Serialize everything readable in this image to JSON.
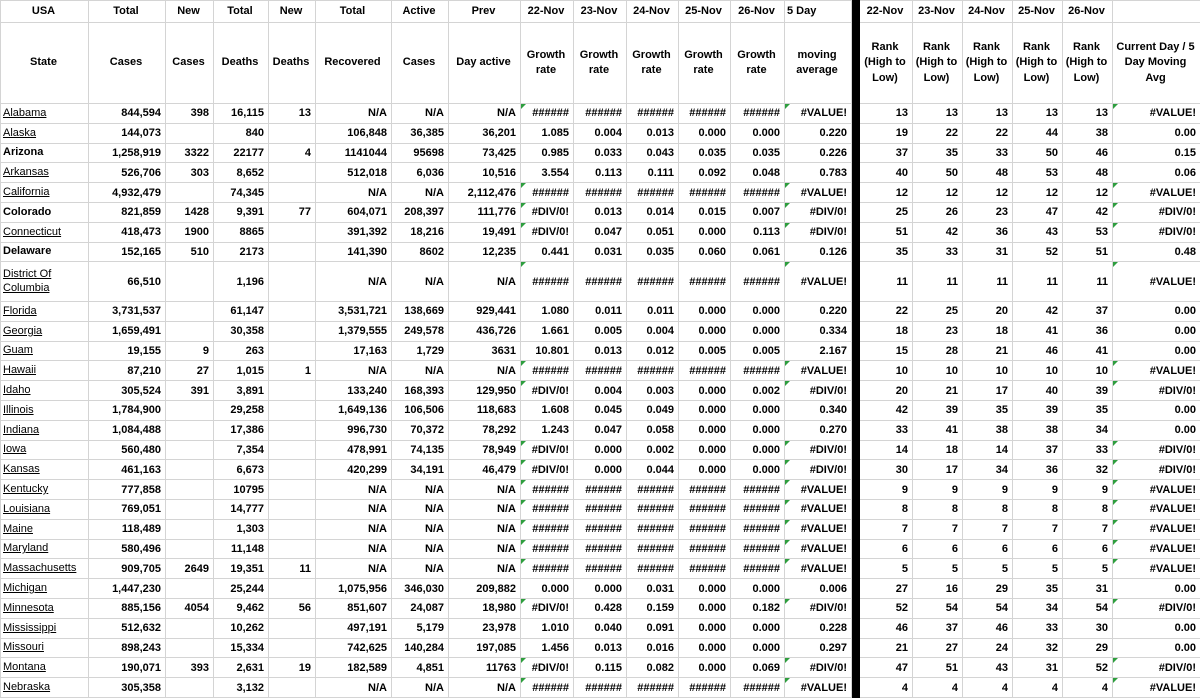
{
  "table": {
    "header_row1": [
      "USA",
      "Total",
      "New",
      "Total",
      "New",
      "Total",
      "Active",
      "Prev",
      "22-Nov",
      "23-Nov",
      "24-Nov",
      "25-Nov",
      "26-Nov",
      "5 Day",
      "22-Nov",
      "23-Nov",
      "24-Nov",
      "25-Nov",
      "26-Nov",
      ""
    ],
    "header_row2": [
      "State",
      "Cases",
      "Cases",
      "Deaths",
      "Deaths",
      "Recovered",
      "Cases",
      "Day active",
      "Growth rate",
      "Growth rate",
      "Growth rate",
      "Growth rate",
      "Growth rate",
      "moving average",
      "Rank (High to Low)",
      "Rank (High to Low)",
      "Rank (High to Low)",
      "Rank (High to Low)",
      "Rank (High to Low)",
      "Current Day / 5 Day Moving Avg"
    ],
    "error_flag_color": "#2e9e3e",
    "divider_color": "#000000",
    "rows": [
      {
        "state": "Alabama",
        "style": "underline",
        "cells": [
          "844,594",
          "398",
          "16,115",
          "13",
          "N/A",
          "N/A",
          "N/A",
          "######",
          "######",
          "######",
          "######",
          "######",
          "#VALUE!",
          "13",
          "13",
          "13",
          "13",
          "13",
          "#VALUE!"
        ]
      },
      {
        "state": "Alaska",
        "style": "underline",
        "cells": [
          "144,073",
          "",
          "840",
          "",
          "106,848",
          "36,385",
          "36,201",
          "1.085",
          "0.004",
          "0.013",
          "0.000",
          "0.000",
          "0.220",
          "19",
          "22",
          "22",
          "44",
          "38",
          "0.00"
        ]
      },
      {
        "state": "Arizona",
        "style": "bold",
        "cells": [
          "1,258,919",
          "3322",
          "22177",
          "4",
          "1141044",
          "95698",
          "73,425",
          "0.985",
          "0.033",
          "0.043",
          "0.035",
          "0.035",
          "0.226",
          "37",
          "35",
          "33",
          "50",
          "46",
          "0.15"
        ]
      },
      {
        "state": "Arkansas",
        "style": "underline",
        "cells": [
          "526,706",
          "303",
          "8,652",
          "",
          "512,018",
          "6,036",
          "10,516",
          "3.554",
          "0.113",
          "0.111",
          "0.092",
          "0.048",
          "0.783",
          "40",
          "50",
          "48",
          "53",
          "48",
          "0.06"
        ]
      },
      {
        "state": "California",
        "style": "underline",
        "cells": [
          "4,932,479",
          "",
          "74,345",
          "",
          "N/A",
          "N/A",
          "2,112,476",
          "######",
          "######",
          "######",
          "######",
          "######",
          "#VALUE!",
          "12",
          "12",
          "12",
          "12",
          "12",
          "#VALUE!"
        ]
      },
      {
        "state": "Colorado",
        "style": "bold",
        "cells": [
          "821,859",
          "1428",
          "9,391",
          "77",
          "604,071",
          "208,397",
          "111,776",
          "#DIV/0!",
          "0.013",
          "0.014",
          "0.015",
          "0.007",
          "#DIV/0!",
          "25",
          "26",
          "23",
          "47",
          "42",
          "#DIV/0!"
        ]
      },
      {
        "state": "Connecticut",
        "style": "underline",
        "cells": [
          "418,473",
          "1900",
          "8865",
          "",
          "391,392",
          "18,216",
          "19,491",
          "#DIV/0!",
          "0.047",
          "0.051",
          "0.000",
          "0.113",
          "#DIV/0!",
          "51",
          "42",
          "36",
          "43",
          "53",
          "#DIV/0!"
        ]
      },
      {
        "state": "Delaware",
        "style": "bold",
        "cells": [
          "152,165",
          "510",
          "2173",
          "",
          "141,390",
          "8602",
          "12,235",
          "0.441",
          "0.031",
          "0.035",
          "0.060",
          "0.061",
          "0.126",
          "35",
          "33",
          "31",
          "52",
          "51",
          "0.48"
        ]
      },
      {
        "state": "District Of Columbia",
        "style": "underline",
        "tall": true,
        "cells": [
          "66,510",
          "",
          "1,196",
          "",
          "N/A",
          "N/A",
          "N/A",
          "######",
          "######",
          "######",
          "######",
          "######",
          "#VALUE!",
          "11",
          "11",
          "11",
          "11",
          "11",
          "#VALUE!"
        ]
      },
      {
        "state": "Florida",
        "style": "underline",
        "cells": [
          "3,731,537",
          "",
          "61,147",
          "",
          "3,531,721",
          "138,669",
          "929,441",
          "1.080",
          "0.011",
          "0.011",
          "0.000",
          "0.000",
          "0.220",
          "22",
          "25",
          "20",
          "42",
          "37",
          "0.00"
        ]
      },
      {
        "state": "Georgia",
        "style": "underline",
        "cells": [
          "1,659,491",
          "",
          "30,358",
          "",
          "1,379,555",
          "249,578",
          "436,726",
          "1.661",
          "0.005",
          "0.004",
          "0.000",
          "0.000",
          "0.334",
          "18",
          "23",
          "18",
          "41",
          "36",
          "0.00"
        ]
      },
      {
        "state": "Guam",
        "style": "underline",
        "cells": [
          "19,155",
          "9",
          "263",
          "",
          "17,163",
          "1,729",
          "3631",
          "10.801",
          "0.013",
          "0.012",
          "0.005",
          "0.005",
          "2.167",
          "15",
          "28",
          "21",
          "46",
          "41",
          "0.00"
        ]
      },
      {
        "state": "Hawaii",
        "style": "underline",
        "cells": [
          "87,210",
          "27",
          "1,015",
          "1",
          "N/A",
          "N/A",
          "N/A",
          "######",
          "######",
          "######",
          "######",
          "######",
          "#VALUE!",
          "10",
          "10",
          "10",
          "10",
          "10",
          "#VALUE!"
        ]
      },
      {
        "state": "Idaho",
        "style": "underline",
        "cells": [
          "305,524",
          "391",
          "3,891",
          "",
          "133,240",
          "168,393",
          "129,950",
          "#DIV/0!",
          "0.004",
          "0.003",
          "0.000",
          "0.002",
          "#DIV/0!",
          "20",
          "21",
          "17",
          "40",
          "39",
          "#DIV/0!"
        ]
      },
      {
        "state": "Illinois",
        "style": "underline",
        "cells": [
          "1,784,900",
          "",
          "29,258",
          "",
          "1,649,136",
          "106,506",
          "118,683",
          "1.608",
          "0.045",
          "0.049",
          "0.000",
          "0.000",
          "0.340",
          "42",
          "39",
          "35",
          "39",
          "35",
          "0.00"
        ]
      },
      {
        "state": "Indiana",
        "style": "underline",
        "cells": [
          "1,084,488",
          "",
          "17,386",
          "",
          "996,730",
          "70,372",
          "78,292",
          "1.243",
          "0.047",
          "0.058",
          "0.000",
          "0.000",
          "0.270",
          "33",
          "41",
          "38",
          "38",
          "34",
          "0.00"
        ]
      },
      {
        "state": "Iowa",
        "style": "underline",
        "cells": [
          "560,480",
          "",
          "7,354",
          "",
          "478,991",
          "74,135",
          "78,949",
          "#DIV/0!",
          "0.000",
          "0.002",
          "0.000",
          "0.000",
          "#DIV/0!",
          "14",
          "18",
          "14",
          "37",
          "33",
          "#DIV/0!"
        ]
      },
      {
        "state": "Kansas",
        "style": "underline",
        "cells": [
          "461,163",
          "",
          "6,673",
          "",
          "420,299",
          "34,191",
          "46,479",
          "#DIV/0!",
          "0.000",
          "0.044",
          "0.000",
          "0.000",
          "#DIV/0!",
          "30",
          "17",
          "34",
          "36",
          "32",
          "#DIV/0!"
        ]
      },
      {
        "state": "Kentucky",
        "style": "underline",
        "cells": [
          "777,858",
          "",
          "10795",
          "",
          "N/A",
          "N/A",
          "N/A",
          "######",
          "######",
          "######",
          "######",
          "######",
          "#VALUE!",
          "9",
          "9",
          "9",
          "9",
          "9",
          "#VALUE!"
        ]
      },
      {
        "state": "Louisiana",
        "style": "underline",
        "cells": [
          "769,051",
          "",
          "14,777",
          "",
          "N/A",
          "N/A",
          "N/A",
          "######",
          "######",
          "######",
          "######",
          "######",
          "#VALUE!",
          "8",
          "8",
          "8",
          "8",
          "8",
          "#VALUE!"
        ]
      },
      {
        "state": "Maine",
        "style": "underline",
        "cells": [
          "118,489",
          "",
          "1,303",
          "",
          "N/A",
          "N/A",
          "N/A",
          "######",
          "######",
          "######",
          "######",
          "######",
          "#VALUE!",
          "7",
          "7",
          "7",
          "7",
          "7",
          "#VALUE!"
        ]
      },
      {
        "state": "Maryland",
        "style": "underline",
        "cells": [
          "580,496",
          "",
          "11,148",
          "",
          "N/A",
          "N/A",
          "N/A",
          "######",
          "######",
          "######",
          "######",
          "######",
          "#VALUE!",
          "6",
          "6",
          "6",
          "6",
          "6",
          "#VALUE!"
        ]
      },
      {
        "state": "Massachusetts",
        "style": "underline",
        "cells": [
          "909,705",
          "2649",
          "19,351",
          "11",
          "N/A",
          "N/A",
          "N/A",
          "######",
          "######",
          "######",
          "######",
          "######",
          "#VALUE!",
          "5",
          "5",
          "5",
          "5",
          "5",
          "#VALUE!"
        ]
      },
      {
        "state": "Michigan",
        "style": "underline",
        "cells": [
          "1,447,230",
          "",
          "25,244",
          "",
          "1,075,956",
          "346,030",
          "209,882",
          "0.000",
          "0.000",
          "0.031",
          "0.000",
          "0.000",
          "0.006",
          "27",
          "16",
          "29",
          "35",
          "31",
          "0.00"
        ]
      },
      {
        "state": "Minnesota",
        "style": "underline",
        "cells": [
          "885,156",
          "4054",
          "9,462",
          "56",
          "851,607",
          "24,087",
          "18,980",
          "#DIV/0!",
          "0.428",
          "0.159",
          "0.000",
          "0.182",
          "#DIV/0!",
          "52",
          "54",
          "54",
          "34",
          "54",
          "#DIV/0!"
        ]
      },
      {
        "state": "Mississippi",
        "style": "underline",
        "cells": [
          "512,632",
          "",
          "10,262",
          "",
          "497,191",
          "5,179",
          "23,978",
          "1.010",
          "0.040",
          "0.091",
          "0.000",
          "0.000",
          "0.228",
          "46",
          "37",
          "46",
          "33",
          "30",
          "0.00"
        ]
      },
      {
        "state": "Missouri",
        "style": "underline",
        "cells": [
          "898,243",
          "",
          "15,334",
          "",
          "742,625",
          "140,284",
          "197,085",
          "1.456",
          "0.013",
          "0.016",
          "0.000",
          "0.000",
          "0.297",
          "21",
          "27",
          "24",
          "32",
          "29",
          "0.00"
        ]
      },
      {
        "state": "Montana",
        "style": "underline",
        "cells": [
          "190,071",
          "393",
          "2,631",
          "19",
          "182,589",
          "4,851",
          "11763",
          "#DIV/0!",
          "0.115",
          "0.082",
          "0.000",
          "0.069",
          "#DIV/0!",
          "47",
          "51",
          "43",
          "31",
          "52",
          "#DIV/0!"
        ]
      },
      {
        "state": "Nebraska",
        "style": "underline",
        "cells": [
          "305,358",
          "",
          "3,132",
          "",
          "N/A",
          "N/A",
          "N/A",
          "######",
          "######",
          "######",
          "######",
          "######",
          "#VALUE!",
          "4",
          "4",
          "4",
          "4",
          "4",
          "#VALUE!"
        ]
      }
    ]
  }
}
